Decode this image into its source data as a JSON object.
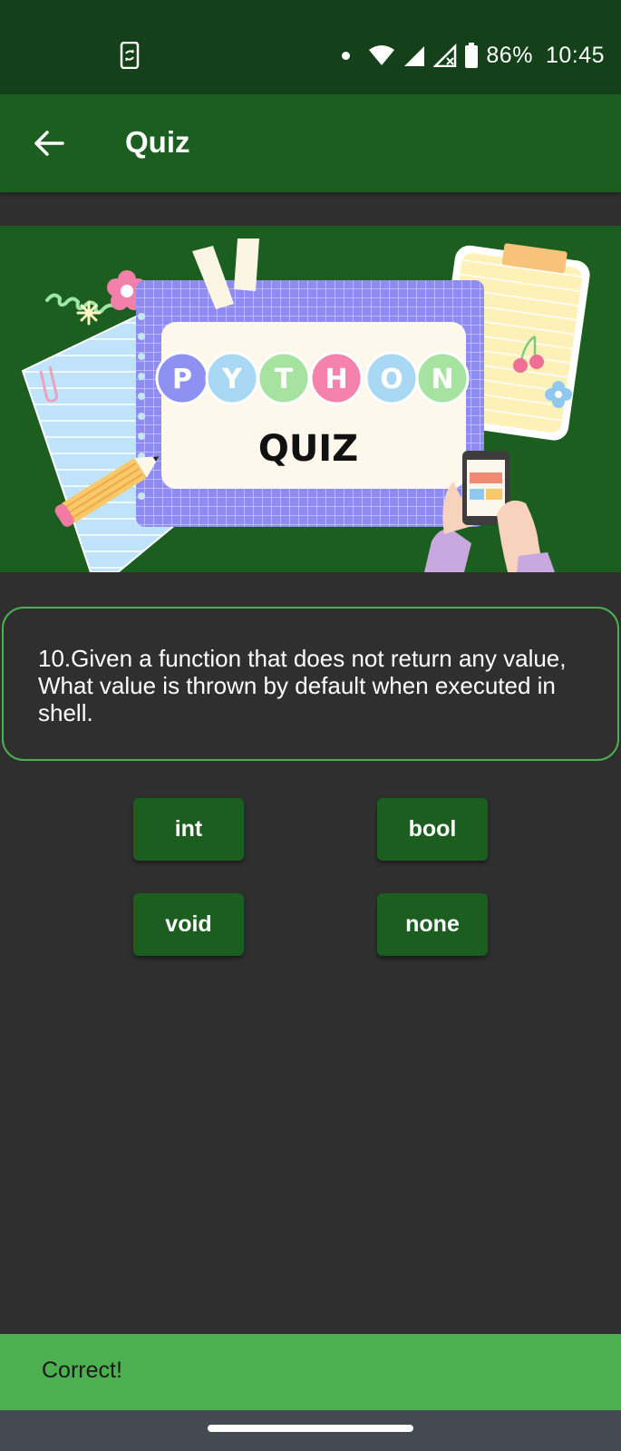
{
  "status_bar": {
    "battery": "86%",
    "time": "10:45",
    "icons": [
      "phone-rotate-icon",
      "dot-icon",
      "wifi-icon",
      "signal-icon",
      "signal-no-data-icon",
      "battery-icon"
    ]
  },
  "app_bar": {
    "title": "Quiz",
    "back_icon": "back-arrow-icon"
  },
  "banner": {
    "letters": [
      "P",
      "Y",
      "T",
      "H",
      "O",
      "N"
    ],
    "letter_colors": [
      "#8e90f2",
      "#a9d8f5",
      "#a6e3a1",
      "#f482ad",
      "#a9d8f5",
      "#a6e3a1"
    ],
    "subtitle": "QUIZ"
  },
  "question": {
    "text": "10.Given a function that does not return any value, What value is thrown by default when executed in shell."
  },
  "options": [
    {
      "label": "int"
    },
    {
      "label": "bool"
    },
    {
      "label": "void"
    },
    {
      "label": "none"
    }
  ],
  "snackbar": {
    "message": "Correct!"
  },
  "colors": {
    "status_bar": "#14411a",
    "app_bar": "#1b5e20",
    "background": "#2f2f2f",
    "accent": "#4caf50",
    "button": "#1b5e20"
  }
}
